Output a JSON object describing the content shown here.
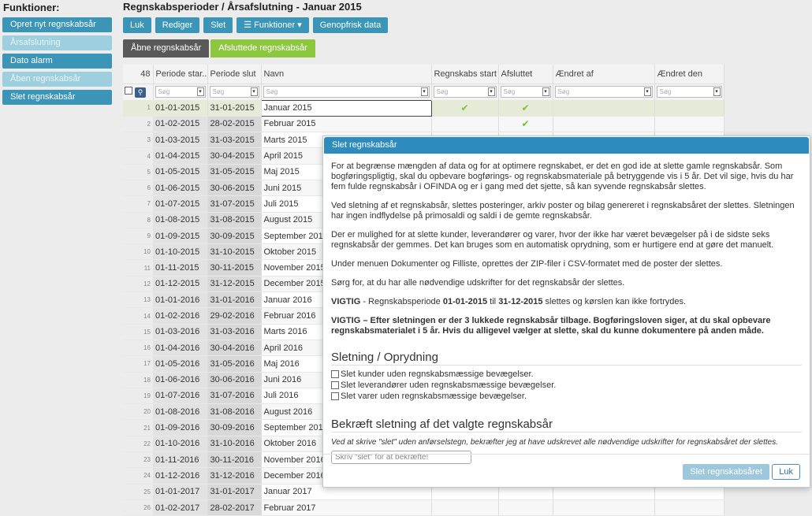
{
  "sidebar": {
    "title": "Funktioner:",
    "items": [
      {
        "label": "Opret nyt regnskabsår"
      },
      {
        "label": "Årsafslutning"
      },
      {
        "label": "Dato alarm"
      },
      {
        "label": "Åben regnskabsår"
      },
      {
        "label": "Slet regnskabsår"
      }
    ]
  },
  "header": {
    "title": "Regnskabsperioder / Årsafslutning - Januar 2015"
  },
  "toolbar": {
    "luk": "Luk",
    "rediger": "Rediger",
    "slet": "Slet",
    "funktioner": "☰ Funktioner ▾",
    "genopfrisk": "Genopfrisk data"
  },
  "tabs": {
    "open": "Åbne regnskabsår",
    "closed": "Afsluttede regnskabsår"
  },
  "grid": {
    "count": "48",
    "columns": {
      "periode_start": "Periode star...",
      "periode_slut": "Periode slut",
      "navn": "Navn",
      "regnskabs_start": "Regnskabs start",
      "afsluttet": "Afsluttet",
      "aendret_af": "Ændret af",
      "aendret_den": "Ændret den"
    },
    "filter_placeholder": "Søg",
    "rows": [
      {
        "i": "1",
        "s": "01-01-2015",
        "e": "31-01-2015",
        "n": "Januar 2015"
      },
      {
        "i": "2",
        "s": "01-02-2015",
        "e": "28-02-2015",
        "n": "Februar 2015"
      },
      {
        "i": "3",
        "s": "01-03-2015",
        "e": "31-03-2015",
        "n": "Marts 2015"
      },
      {
        "i": "4",
        "s": "01-04-2015",
        "e": "30-04-2015",
        "n": "April 2015"
      },
      {
        "i": "5",
        "s": "01-05-2015",
        "e": "31-05-2015",
        "n": "Maj 2015"
      },
      {
        "i": "6",
        "s": "01-06-2015",
        "e": "30-06-2015",
        "n": "Juni 2015"
      },
      {
        "i": "7",
        "s": "01-07-2015",
        "e": "31-07-2015",
        "n": "Juli 2015"
      },
      {
        "i": "8",
        "s": "01-08-2015",
        "e": "31-08-2015",
        "n": "August 2015"
      },
      {
        "i": "9",
        "s": "01-09-2015",
        "e": "30-09-2015",
        "n": "September 2015"
      },
      {
        "i": "10",
        "s": "01-10-2015",
        "e": "31-10-2015",
        "n": "Oktober 2015"
      },
      {
        "i": "11",
        "s": "01-11-2015",
        "e": "30-11-2015",
        "n": "November 2015"
      },
      {
        "i": "12",
        "s": "01-12-2015",
        "e": "31-12-2015",
        "n": "December 2015"
      },
      {
        "i": "13",
        "s": "01-01-2016",
        "e": "31-01-2016",
        "n": "Januar 2016"
      },
      {
        "i": "14",
        "s": "01-02-2016",
        "e": "29-02-2016",
        "n": "Februar 2016"
      },
      {
        "i": "15",
        "s": "01-03-2016",
        "e": "31-03-2016",
        "n": "Marts 2016"
      },
      {
        "i": "16",
        "s": "01-04-2016",
        "e": "30-04-2016",
        "n": "April 2016"
      },
      {
        "i": "17",
        "s": "01-05-2016",
        "e": "31-05-2016",
        "n": "Maj 2016"
      },
      {
        "i": "18",
        "s": "01-06-2016",
        "e": "30-06-2016",
        "n": "Juni 2016"
      },
      {
        "i": "19",
        "s": "01-07-2016",
        "e": "31-07-2016",
        "n": "Juli 2016"
      },
      {
        "i": "20",
        "s": "01-08-2016",
        "e": "31-08-2016",
        "n": "August 2016"
      },
      {
        "i": "21",
        "s": "01-09-2016",
        "e": "30-09-2016",
        "n": "September 2016"
      },
      {
        "i": "22",
        "s": "01-10-2016",
        "e": "31-10-2016",
        "n": "Oktober 2016"
      },
      {
        "i": "23",
        "s": "01-11-2016",
        "e": "30-11-2016",
        "n": "November 2016"
      },
      {
        "i": "24",
        "s": "01-12-2016",
        "e": "31-12-2016",
        "n": "December 2016"
      },
      {
        "i": "25",
        "s": "01-01-2017",
        "e": "31-01-2017",
        "n": "Januar 2017"
      },
      {
        "i": "26",
        "s": "01-02-2017",
        "e": "28-02-2017",
        "n": "Februar 2017"
      }
    ]
  },
  "dialog": {
    "title": "Slet regnskabsår",
    "p1": "For at begrænse mængden af data og for at optimere regnskabet, er det en god ide at slette gamle regnskabsår. Som bogføringspligtig, skal du opbevare bogførings- og regnskabsmateriale på betryggende vis i 5 år. Det vil sige, hvis du har fem fulde regnskabsår i OFINDA og er i gang med det sjette, så kan syvende regnskabsår slettes.",
    "p2": "Ved sletning af et regnskabsår, slettes posteringer, arkiv poster og bilag genereret i regnskabsåret der slettes. Sletningen har ingen indflydelse på primosaldi og saldi i de gemte regnskabsår.",
    "p3": "Der er mulighed for at slette kunder, leverandører og varer, hvor der ikke har været bevægelser på i de sidste seks regnskabsår der gemmes. Det kan bruges som en automatisk oprydning, som er hurtigere end at gøre det manuelt.",
    "p4": "Under menuen Dokumenter og Filliste, oprettes der ZIP-filer i CSV-formatet med de poster der slettes.",
    "p5": "Sørg for, at du har alle nødvendige udskrifter for det regnskabsår der slettes.",
    "warn1": {
      "lead": "VIGTIG",
      "mid1": " - Regnskabsperiode ",
      "from": "01-01-2015",
      "mid2": " til ",
      "to": "31-12-2015",
      "tail": " slettes og kørslen kan ikke fortrydes."
    },
    "warn2": "VIGTIG – Efter sletningen er der 3 lukkede regnskabsår tilbage. Bogføringsloven siger, at du skal opbevare regnskabsmaterialet i 5 år. Hvis du alligevel vælger at slette, skal du kunne dokumentere på anden måde.",
    "section1": "Sletning / Oprydning",
    "opt1": "Slet kunder uden regnskabsmæssige bevægelser.",
    "opt2": "Slet leverandører uden regnskabsmæssige bevægelser.",
    "opt3": "Slet varer uden regnskabsmæssige bevægelser.",
    "section2": "Bekræft sletning af det valgte regnskabsår",
    "confirm_note": "Ved at skrive \"slet\" uden anførselstegn, bekræfter jeg at have udskrevet alle nødvendige udskrifter for regnskabsåret der slettes.",
    "confirm_placeholder": "Skriv \"slet\" for at bekræfte!",
    "btn_delete": "Slet regnskabsåret",
    "btn_close": "Luk"
  }
}
